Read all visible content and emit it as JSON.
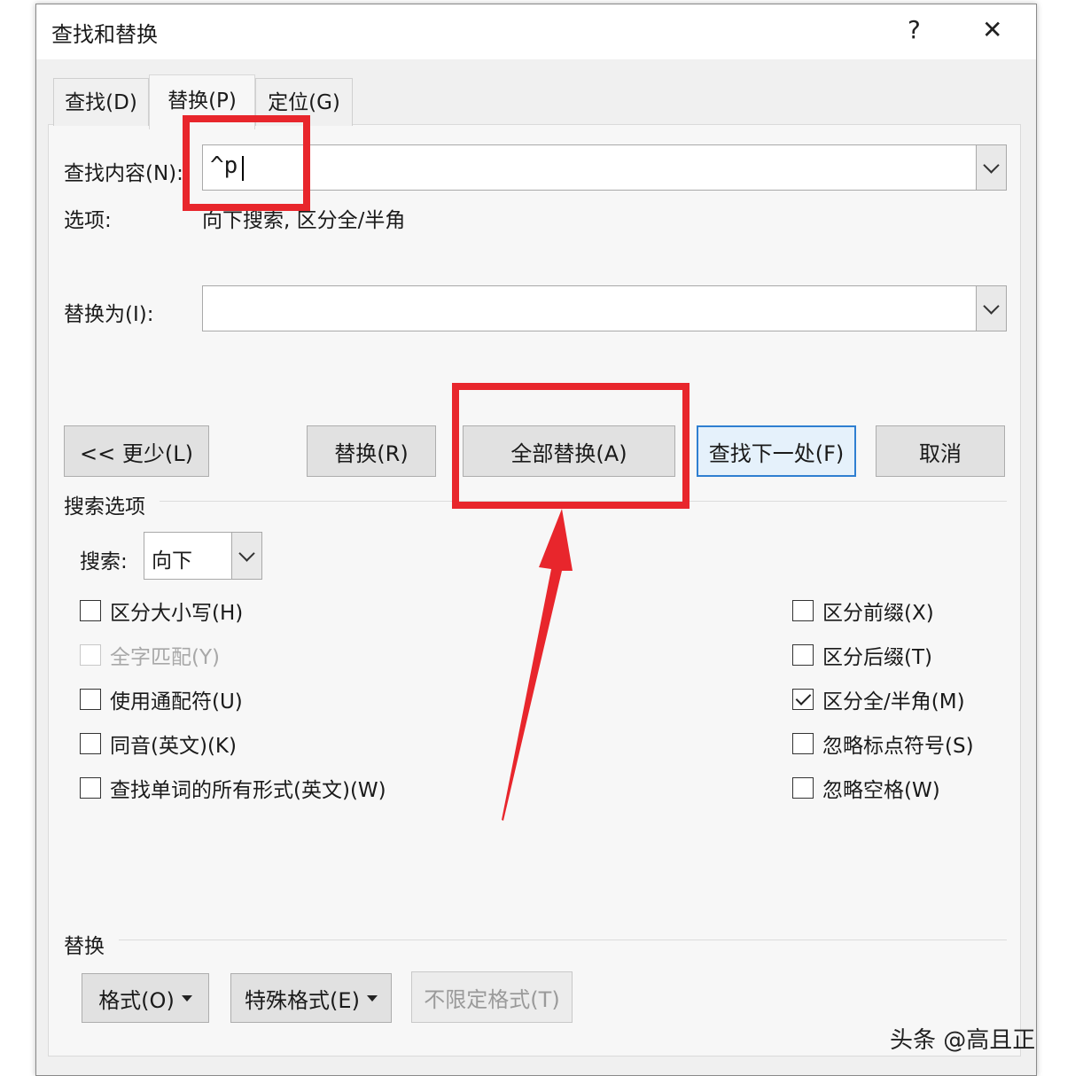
{
  "window": {
    "title": "查找和替换",
    "help": "?",
    "close": "✕"
  },
  "tabs": [
    {
      "label": "查找(D)",
      "active": false
    },
    {
      "label": "替换(P)",
      "active": true
    },
    {
      "label": "定位(G)",
      "active": false
    }
  ],
  "find": {
    "label": "查找内容(N):",
    "value": "^p"
  },
  "options": {
    "label": "选项:",
    "value": "向下搜索, 区分全/半角"
  },
  "replace": {
    "label": "替换为(I):",
    "value": ""
  },
  "buttons": {
    "less": "<< 更少(L)",
    "replace": "替换(R)",
    "replace_all": "全部替换(A)",
    "find_next": "查找下一处(F)",
    "cancel": "取消"
  },
  "search_options": {
    "heading": "搜索选项",
    "direction_label": "搜索:",
    "direction_value": "向下",
    "left": [
      {
        "label": "区分大小写(H)",
        "checked": false,
        "enabled": true
      },
      {
        "label": "全字匹配(Y)",
        "checked": false,
        "enabled": false
      },
      {
        "label": "使用通配符(U)",
        "checked": false,
        "enabled": true
      },
      {
        "label": "同音(英文)(K)",
        "checked": false,
        "enabled": true
      },
      {
        "label": "查找单词的所有形式(英文)(W)",
        "checked": false,
        "enabled": true
      }
    ],
    "right": [
      {
        "label": "区分前缀(X)",
        "checked": false,
        "enabled": true
      },
      {
        "label": "区分后缀(T)",
        "checked": false,
        "enabled": true
      },
      {
        "label": "区分全/半角(M)",
        "checked": true,
        "enabled": true
      },
      {
        "label": "忽略标点符号(S)",
        "checked": false,
        "enabled": true
      },
      {
        "label": "忽略空格(W)",
        "checked": false,
        "enabled": true
      }
    ]
  },
  "replace_section": {
    "heading": "替换",
    "format": "格式(O)",
    "special": "特殊格式(E)",
    "no_format": "不限定格式(T)"
  },
  "annotation": {
    "color": "#e8262c"
  },
  "watermark": "头条 @高且正"
}
